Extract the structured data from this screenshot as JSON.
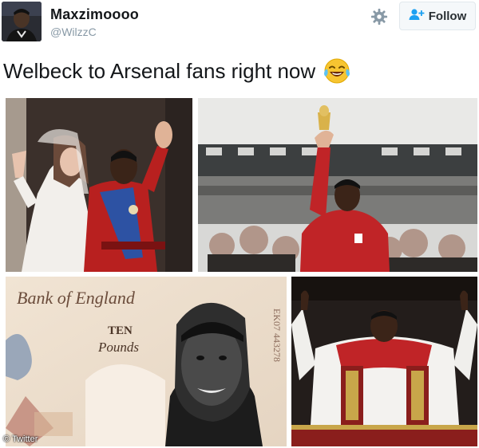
{
  "user": {
    "name": "Maxzimoooo",
    "handle": "@WilzzC"
  },
  "follow_button": {
    "label": "Follow"
  },
  "tweet": {
    "text": "Welbeck to Arsenal fans right now",
    "emoji": "face-with-tears-of-joy"
  },
  "banknote": {
    "bank_text": "Bank of England",
    "value_word": "TEN",
    "unit_word": "Pounds",
    "serial": "EK07 443278"
  },
  "watermark": "© Twitter",
  "colors": {
    "follow_accent": "#1da1f2",
    "text": "#14171a",
    "muted": "#8899a6"
  }
}
